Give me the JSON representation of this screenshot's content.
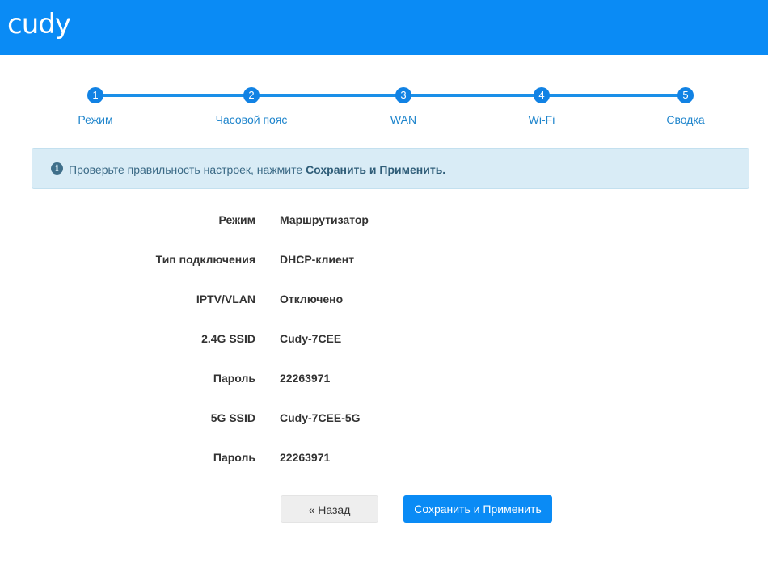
{
  "header": {
    "logo": "cudy",
    "color": "#0a8bf5"
  },
  "stepper": {
    "steps": [
      {
        "number": "1",
        "label": "Режим"
      },
      {
        "number": "2",
        "label": "Часовой пояс"
      },
      {
        "number": "3",
        "label": "WAN"
      },
      {
        "number": "4",
        "label": "Wi-Fi"
      },
      {
        "number": "5",
        "label": "Сводка"
      }
    ],
    "current_step": 5
  },
  "alert": {
    "icon": "info-icon",
    "text": "Проверьте правильность настроек, нажмите ",
    "emphasis": "Сохранить и Применить."
  },
  "summary": [
    {
      "key": "Режим",
      "value": "Маршрутизатор"
    },
    {
      "key": "Тип подключения",
      "value": "DHCP-клиент"
    },
    {
      "key": "IPTV/VLAN",
      "value": "Отключено"
    },
    {
      "key": "2.4G SSID",
      "value": "Cudy-7CEE"
    },
    {
      "key": "Пароль",
      "value": "22263971"
    },
    {
      "key": "5G SSID",
      "value": "Cudy-7CEE-5G"
    },
    {
      "key": "Пароль",
      "value": "22263971"
    }
  ],
  "buttons": {
    "back": "« Назад",
    "save": "Сохранить и Применить"
  }
}
